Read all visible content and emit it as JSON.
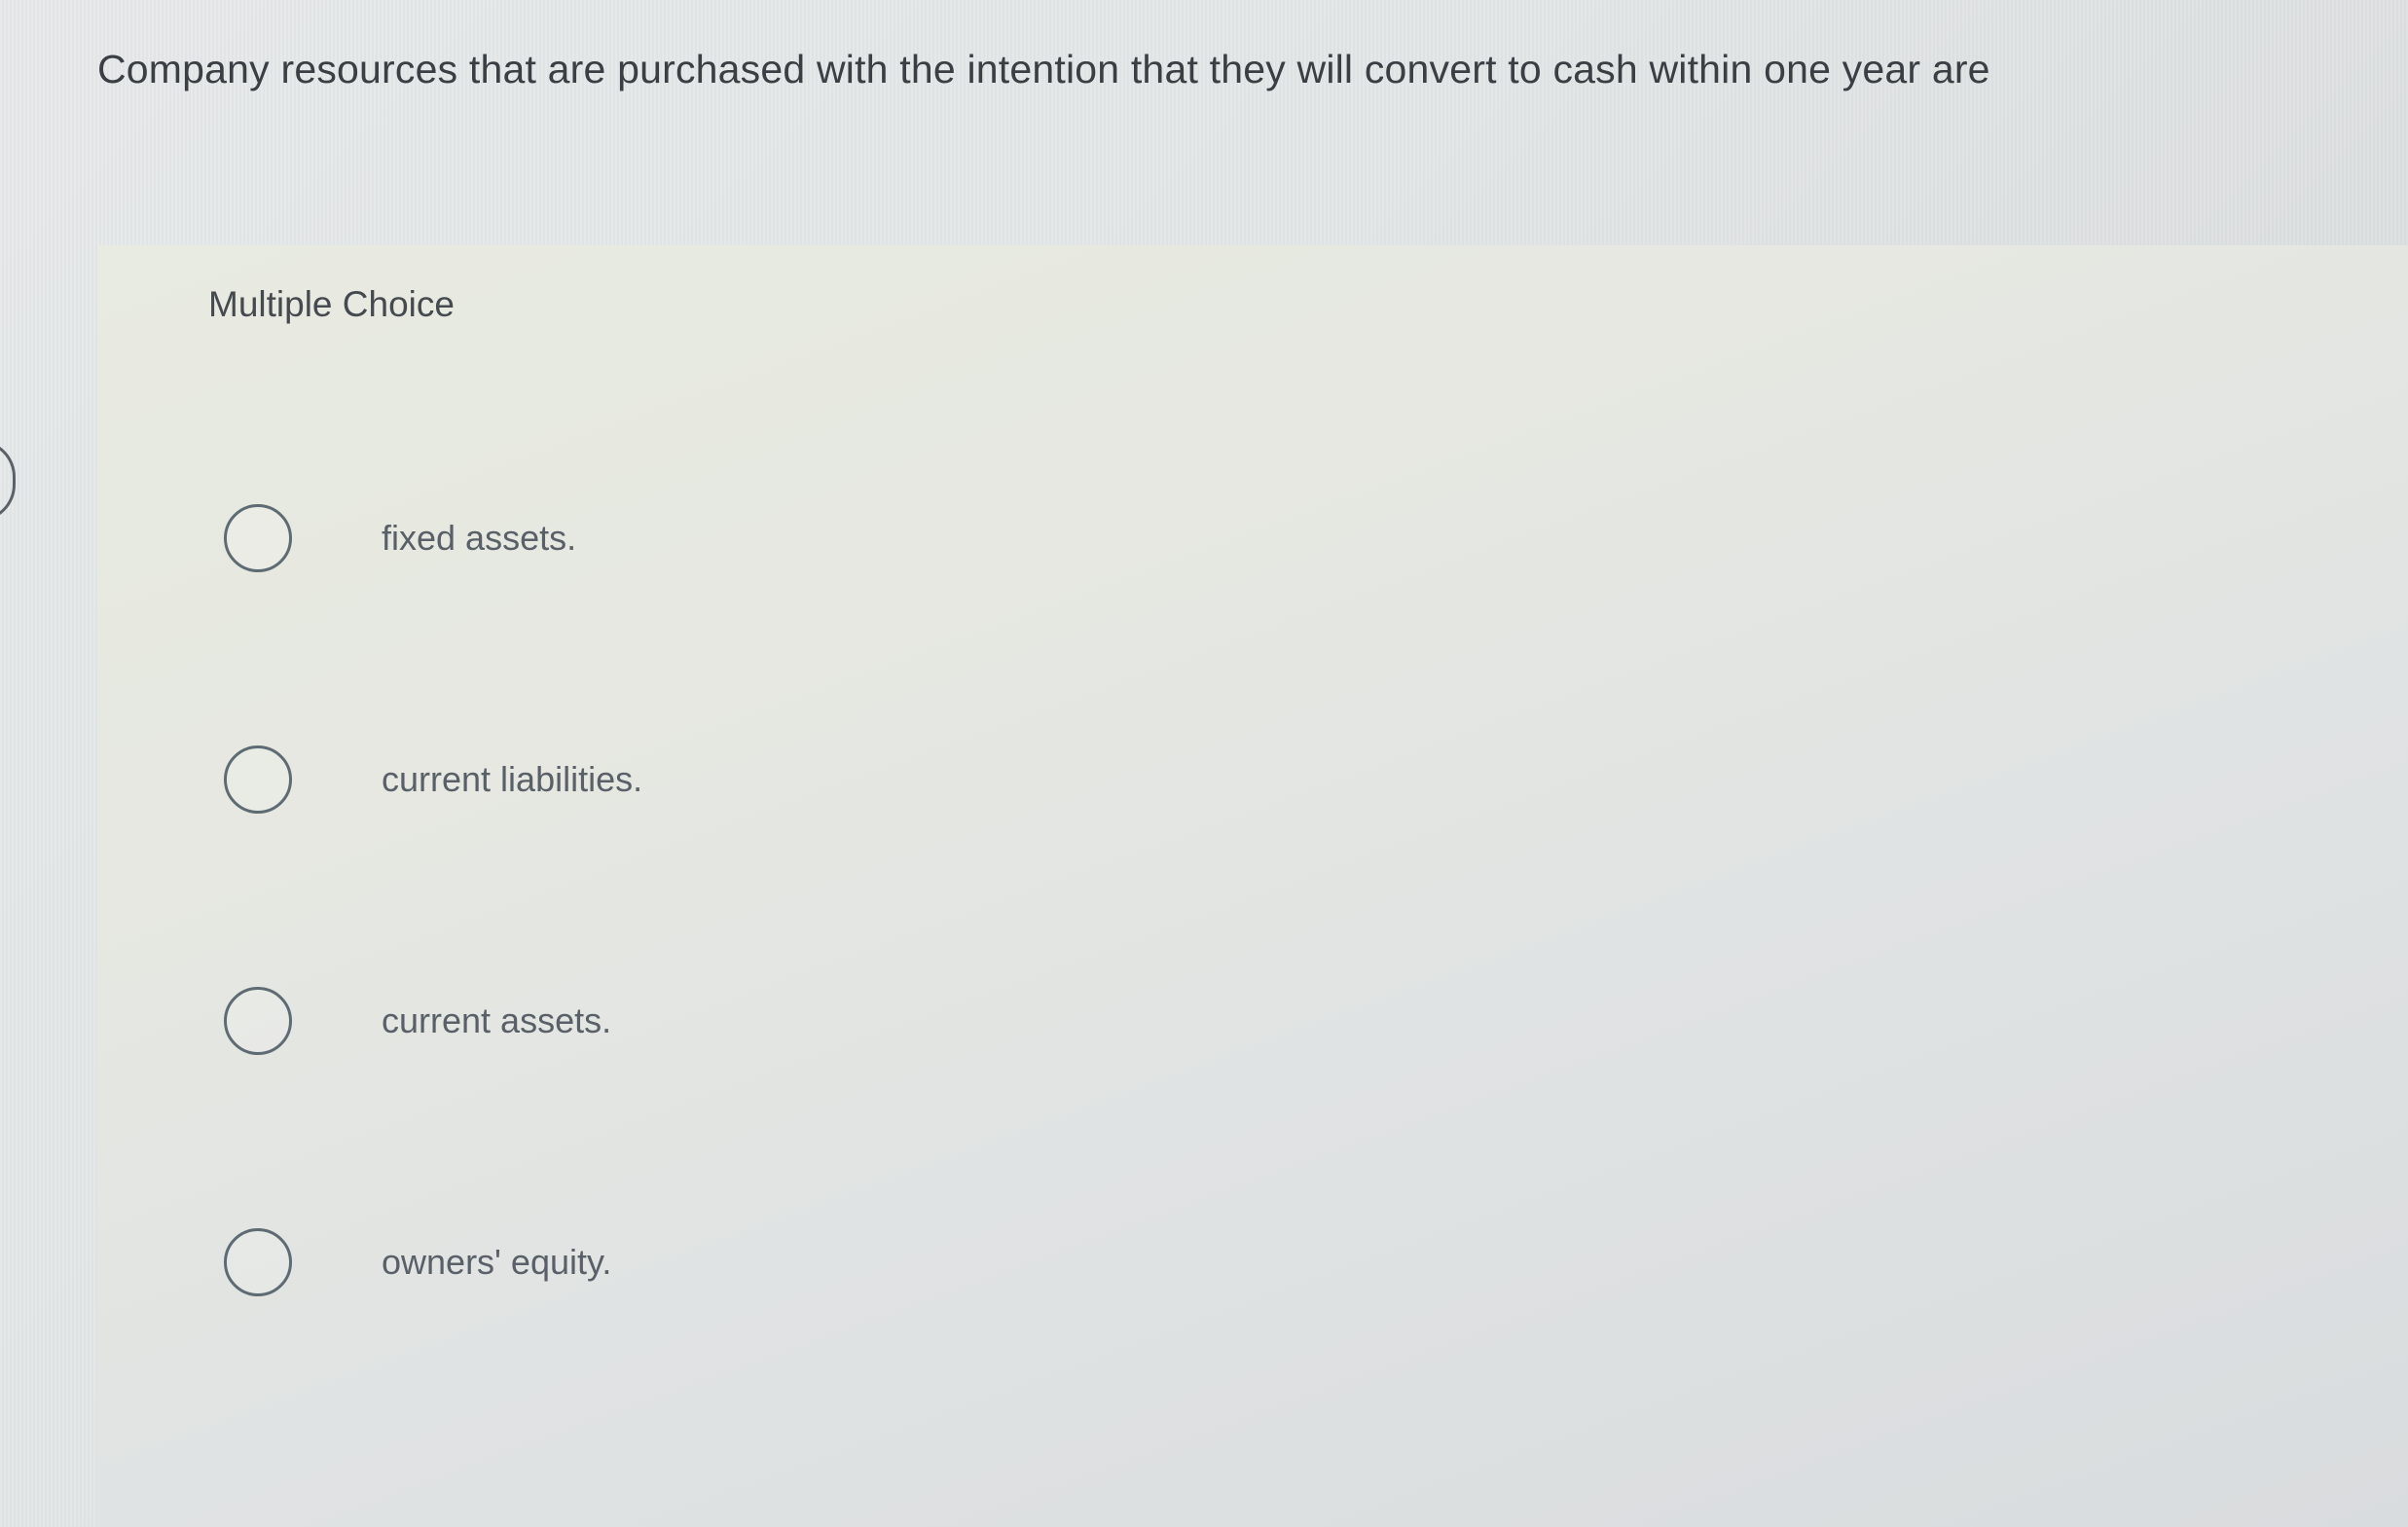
{
  "question": {
    "text": "Company resources that are purchased with the intention that they will convert to cash within one year are"
  },
  "panel": {
    "label": "Multiple Choice"
  },
  "choices": [
    {
      "label": "fixed assets."
    },
    {
      "label": "current liabilities."
    },
    {
      "label": "current assets."
    },
    {
      "label": "owners' equity."
    }
  ],
  "colors": {
    "text_primary": "#3a3f44",
    "text_choice": "#596068",
    "radio_border": "#5f6b73"
  }
}
